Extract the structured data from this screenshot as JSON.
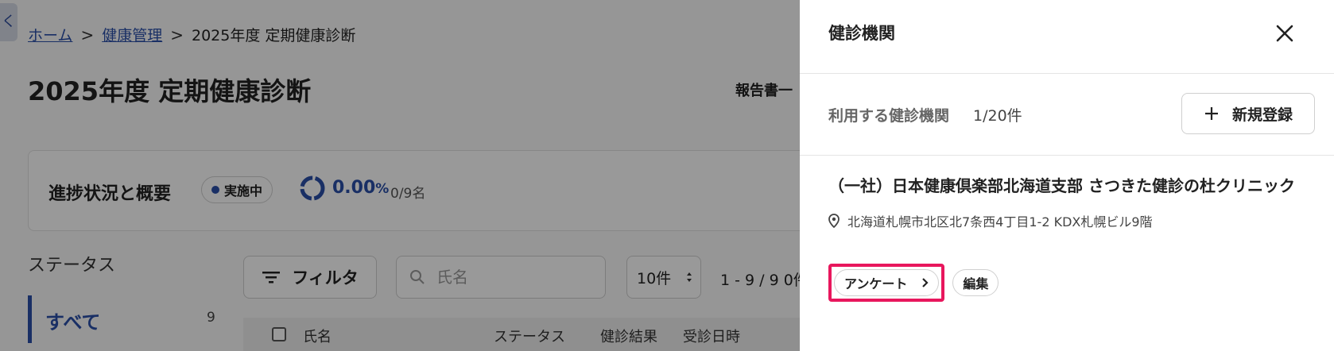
{
  "background_page": {
    "collapse_glyph": "く",
    "breadcrumb": {
      "home": "ホーム",
      "health": "健康管理",
      "current": "2025年度 定期健康診断",
      "separator": ">"
    },
    "title": "2025年度 定期健康診断",
    "report_button": "報告書一",
    "progress": {
      "heading": "進捗状況と概要",
      "status_badge": "実施中",
      "percent_value": "0.00",
      "percent_unit": "%",
      "progress_fraction": 0.0,
      "count": "0/9名"
    },
    "status_sidebar": {
      "heading": "ステータス",
      "all_label": "すべて",
      "all_count": "9"
    },
    "toolbar": {
      "filter_label": "フィルタ",
      "name_placeholder": "氏名",
      "per_page": "10件",
      "pager": "1 - 9 / 9  0件"
    },
    "table_headers": [
      "氏名",
      "ステータス",
      "健診結果",
      "受診日時"
    ]
  },
  "drawer": {
    "title": "健診機関",
    "org_label": "利用する健診機関",
    "org_count": "1/20件",
    "new_button": "新規登録",
    "clinic": {
      "name": "（一社）日本健康倶楽部北海道支部 さつきた健診の杜クリニック",
      "address": "北海道札幌市北区北7条西4丁目1-2 KDX札幌ビル9階",
      "survey_button": "アンケート",
      "edit_button": "編集"
    }
  },
  "colors": {
    "accent_blue": "#2a4fa8",
    "highlight_pink": "#e8175d",
    "overlay": "rgba(0,0,0,0.40)"
  },
  "icons": {
    "close": "close-icon",
    "plus": "plus-icon",
    "location": "location-pin-icon",
    "chevron": "chevron-right-icon",
    "filter": "filter-icon",
    "search": "search-icon"
  }
}
